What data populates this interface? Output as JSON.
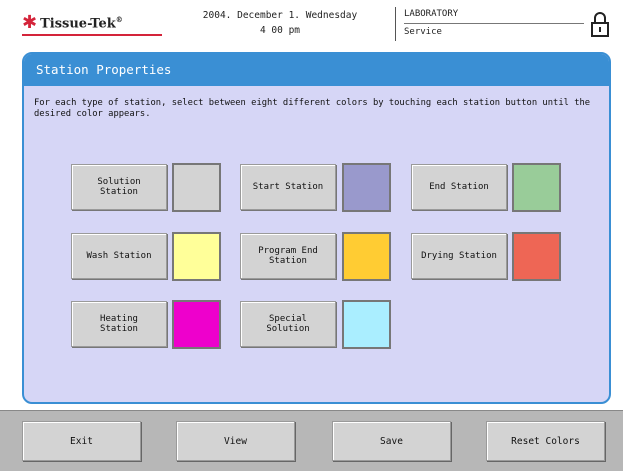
{
  "header": {
    "logo_text": "Tissue-Tek",
    "logo_mark": "®",
    "date_line": "2004. December 1. Wednesday",
    "time_line": "4 00 pm",
    "location": "LABORATORY",
    "role": "Service",
    "lock_icon": "padlock-icon"
  },
  "panel": {
    "title": "Station Properties",
    "instructions": "For each type of station, select between eight different colors by touching each station button until the desired color appears."
  },
  "stations": {
    "solution": {
      "label": "Solution\nStation",
      "color": "#d3d3d3"
    },
    "start": {
      "label": "Start Station",
      "color": "#9999cc"
    },
    "end": {
      "label": "End Station",
      "color": "#99cc99"
    },
    "wash": {
      "label": "Wash Station",
      "color": "#ffff99"
    },
    "program_end": {
      "label": "Program End\nStation",
      "color": "#ffcc33"
    },
    "drying": {
      "label": "Drying Station",
      "color": "#ee6655"
    },
    "heating": {
      "label": "Heating\nStation",
      "color": "#ee00cc"
    },
    "special": {
      "label": "Special\nSolution",
      "color": "#aaeeff"
    }
  },
  "footer": {
    "exit": "Exit",
    "view": "View",
    "save": "Save",
    "reset": "Reset Colors"
  }
}
